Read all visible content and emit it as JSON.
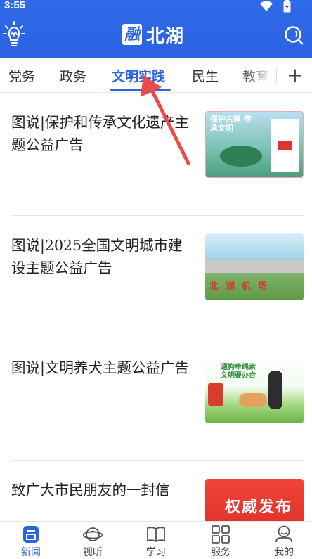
{
  "status_bar": {
    "time": "3:55"
  },
  "app": {
    "logo_mark": "融",
    "logo_text": "北湖"
  },
  "tabs": [
    {
      "label": "党务"
    },
    {
      "label": "政务"
    },
    {
      "label": "文明实践",
      "active": true
    },
    {
      "label": "民生"
    },
    {
      "label": "教育"
    }
  ],
  "tab_add_label": "+",
  "articles": [
    {
      "title": "图说|保护和传承文化遗产主题公益广告",
      "thumb_text": "保护古建 传承文明"
    },
    {
      "title": "图说|2025全国文明城市建设主题公益广告",
      "thumb_text": "北湖机场"
    },
    {
      "title": "图说|文明养犬主题公益广告",
      "thumb_text": "遛狗牵绳索 文明要办合"
    },
    {
      "title": "致广大市民朋友的一封信",
      "thumb_text": "权威发布"
    }
  ],
  "bottom_nav": [
    {
      "label": "新闻",
      "icon": "news-icon",
      "active": true
    },
    {
      "label": "视听",
      "icon": "planet-icon"
    },
    {
      "label": "学习",
      "icon": "book-icon"
    },
    {
      "label": "服务",
      "icon": "grid-icon"
    },
    {
      "label": "我的",
      "icon": "profile-icon"
    }
  ],
  "colors": {
    "brand_blue": "#2b63e3",
    "arrow_red": "#ef4a4a"
  }
}
